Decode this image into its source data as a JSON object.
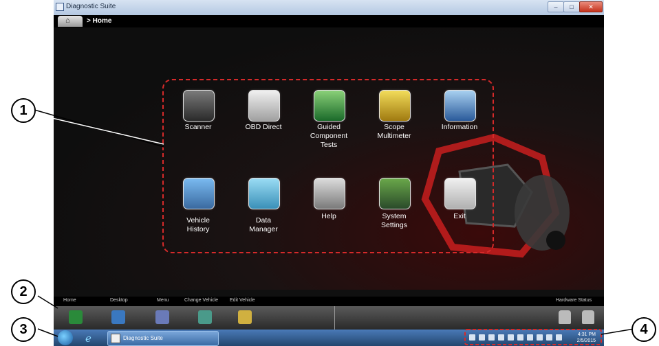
{
  "window": {
    "title": "Diagnostic Suite",
    "min_label": "–",
    "max_label": "□",
    "close_label": "✕"
  },
  "breadcrumb": {
    "text": "> Home"
  },
  "apps": [
    {
      "label": "Scanner",
      "icon": "scanner-icon"
    },
    {
      "label": "OBD Direct",
      "icon": "obd-connector-icon"
    },
    {
      "label": "Guided\nComponent\nTests",
      "icon": "guided-tests-icon"
    },
    {
      "label": "Scope\nMultimeter",
      "icon": "scope-multimeter-icon"
    },
    {
      "label": "Information",
      "icon": "information-icon"
    },
    {
      "label": "Vehicle\nHistory",
      "icon": "vehicle-history-icon"
    },
    {
      "label": "Data\nManager",
      "icon": "data-manager-folder-icon"
    },
    {
      "label": "Help",
      "icon": "help-icon"
    },
    {
      "label": "System\nSettings",
      "icon": "system-settings-gears-icon"
    },
    {
      "label": "Exit",
      "icon": "power-exit-icon"
    }
  ],
  "toolbar": {
    "labels": [
      "Home",
      "Desktop",
      "Menu",
      "Change Vehicle",
      "Edit Vehicle"
    ],
    "hardware_status": "Hardware Status"
  },
  "taskbar": {
    "task_item": "Diagnostic Suite",
    "clock_time": "4:31 PM",
    "clock_date": "2/5/2015"
  },
  "callouts": [
    "1",
    "2",
    "3",
    "4"
  ],
  "colors": {
    "accent_red": "#d62a2a",
    "background": "#101010"
  }
}
